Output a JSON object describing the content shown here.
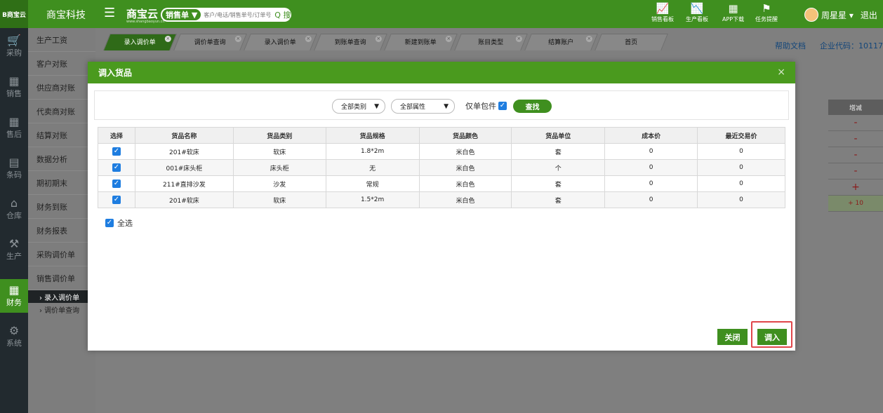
{
  "app": {
    "logo_text": "B商宝云",
    "company": "商宝科技",
    "brand": "商宝云",
    "brand_sub": "www.shangbaoyun.cn",
    "search_type": "销售单 ▼",
    "search_placeholder": "客户/电话/销售单号/订单号",
    "search_button": "Q 搜索"
  },
  "top_actions": [
    {
      "icon": "chart-icon",
      "glyph": "📈",
      "label": "销售看板"
    },
    {
      "icon": "chart-icon",
      "glyph": "📉",
      "label": "生产看板"
    },
    {
      "icon": "qr-icon",
      "glyph": "▦",
      "label": "APP下载"
    },
    {
      "icon": "flag-icon",
      "glyph": "⚑",
      "label": "任务提醒"
    }
  ],
  "user": {
    "name": "周星星 ▾",
    "logout": "退出"
  },
  "rail": [
    {
      "icon": "cart-icon",
      "glyph": "🛒",
      "label": "采购"
    },
    {
      "icon": "grid-icon",
      "glyph": "▦",
      "label": "销售"
    },
    {
      "icon": "grid-icon",
      "glyph": "▦",
      "label": "售后"
    },
    {
      "icon": "barcode-icon",
      "glyph": "▤",
      "label": "条码"
    },
    {
      "icon": "warehouse-icon",
      "glyph": "⌂",
      "label": "仓库"
    },
    {
      "icon": "factory-icon",
      "glyph": "⚒",
      "label": "生产"
    },
    {
      "icon": "calculator-icon",
      "glyph": "▦",
      "label": "财务"
    },
    {
      "icon": "gear-icon",
      "glyph": "⚙",
      "label": "系统"
    }
  ],
  "side_menu": [
    "生产工资",
    "客户对账",
    "供应商对账",
    "代卖商对账",
    "结算对账",
    "数据分析",
    "期初期末",
    "财务到账",
    "财务报表",
    "采购调价单",
    "销售调价单"
  ],
  "side_sub": [
    "› 录入调价单",
    "› 调价单查询"
  ],
  "tabs": [
    "录入调价单",
    "调价单查询",
    "录入调价单",
    "到账单查询",
    "新建到账单",
    "账目类型",
    "结算账户",
    "首页"
  ],
  "help": {
    "doc": "帮助文档",
    "code": "企业代码：10117"
  },
  "bg_table": {
    "header": "增减",
    "rows": [
      "-",
      "-",
      "-",
      "-",
      "+",
      "+ 10"
    ]
  },
  "modal": {
    "title": "调入货品",
    "close_x": "×",
    "filter": {
      "category": "全部类别",
      "attribute": "全部属性",
      "only_package": "仅单包件",
      "find": "查找"
    },
    "columns": [
      "选择",
      "货品名称",
      "货品类别",
      "货品规格",
      "货品颜色",
      "货品单位",
      "成本价",
      "最近交易价"
    ],
    "rows": [
      [
        "201#软床",
        "软床",
        "1.8*2m",
        "米白色",
        "套",
        "0",
        "0"
      ],
      [
        "001#床头柜",
        "床头柜",
        "无",
        "米白色",
        "个",
        "0",
        "0"
      ],
      [
        "211#直排沙发",
        "沙发",
        "常规",
        "米白色",
        "套",
        "0",
        "0"
      ],
      [
        "201#软床",
        "软床",
        "1.5*2m",
        "米白色",
        "套",
        "0",
        "0"
      ]
    ],
    "select_all": "全选",
    "close_button": "关闭",
    "import_button": "调入"
  }
}
